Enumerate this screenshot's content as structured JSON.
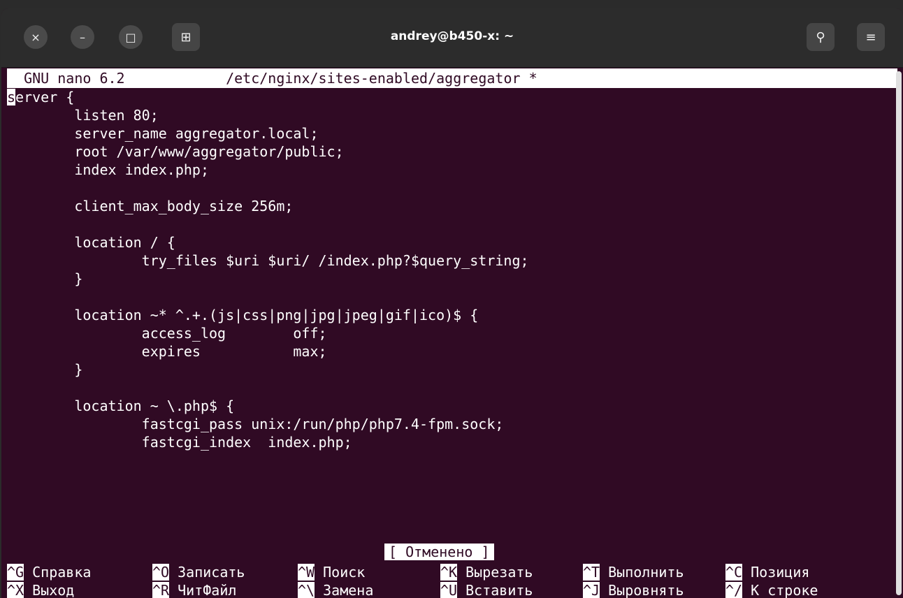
{
  "window": {
    "title": "andrey@b450-x: ~"
  },
  "titlebar": {
    "close_icon": "×",
    "minimize_icon": "–",
    "maximize_icon": "□",
    "new_tab_icon": "⊞",
    "search_icon": "⚲",
    "menu_icon": "≡"
  },
  "nano": {
    "version": "GNU nano 6.2",
    "file": "/etc/nginx/sites-enabled/aggregator *",
    "cursor_char": "s",
    "first_line_rest": "erver {",
    "lines": [
      "        listen 80;",
      "        server_name aggregator.local;",
      "        root /var/www/aggregator/public;",
      "        index index.php;",
      "",
      "        client_max_body_size 256m;",
      "",
      "        location / {",
      "                try_files $uri $uri/ /index.php?$query_string;",
      "        }",
      "",
      "        location ~* ^.+.(js|css|png|jpg|jpeg|gif|ico)$ {",
      "                access_log        off;",
      "                expires           max;",
      "        }",
      "",
      "        location ~ \\.php$ {",
      "                fastcgi_pass unix:/run/php/php7.4-fpm.sock;",
      "                fastcgi_index  index.php;"
    ],
    "status": "[ Отменено ]",
    "shortcuts_row1": [
      {
        "key": "^G",
        "label": "Справка"
      },
      {
        "key": "^O",
        "label": "Записать"
      },
      {
        "key": "^W",
        "label": "Поиск"
      },
      {
        "key": "^K",
        "label": "Вырезать"
      },
      {
        "key": "^T",
        "label": "Выполнить"
      },
      {
        "key": "^C",
        "label": "Позиция"
      }
    ],
    "shortcuts_row2": [
      {
        "key": "^X",
        "label": "Выход"
      },
      {
        "key": "^R",
        "label": "ЧитФайл"
      },
      {
        "key": "^\\",
        "label": "Замена"
      },
      {
        "key": "^U",
        "label": "Вставить"
      },
      {
        "key": "^J",
        "label": "Выровнять"
      },
      {
        "key": "^/",
        "label": "К строке"
      }
    ]
  }
}
